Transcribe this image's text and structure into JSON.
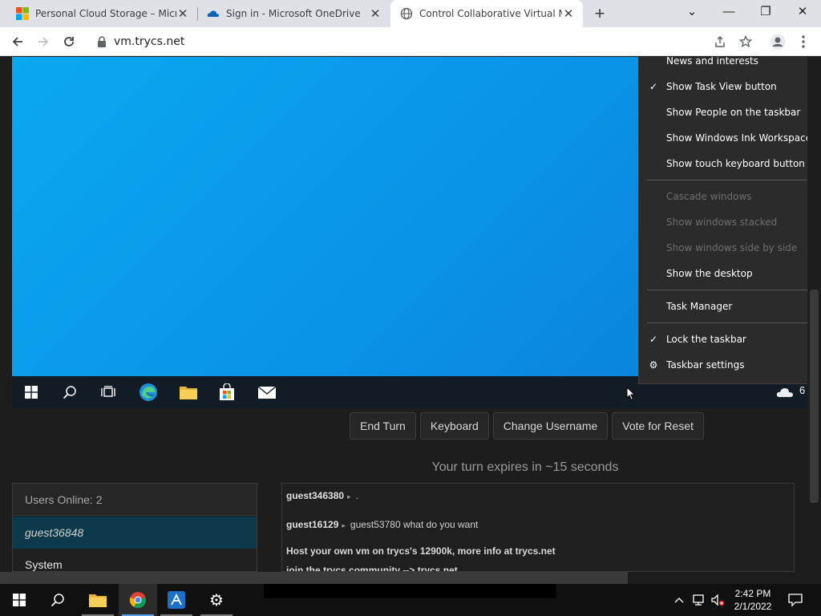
{
  "browser": {
    "tabs": [
      {
        "title": "Personal Cloud Storage – Microsoft OneDrive",
        "active": false
      },
      {
        "title": "Sign in - Microsoft OneDrive",
        "active": false
      },
      {
        "title": "Control Collaborative Virtual Machines",
        "active": true
      }
    ],
    "new_tab": "+",
    "window_controls": {
      "minimize": "—",
      "restore": "❐",
      "close": "✕",
      "tab_search": "⌄"
    },
    "url": "vm.trycs.net"
  },
  "context_menu": {
    "items": [
      {
        "label": "News and interests",
        "checked": false,
        "disabled": false
      },
      {
        "label": "Show Task View button",
        "checked": true,
        "disabled": false
      },
      {
        "label": "Show People on the taskbar",
        "checked": false,
        "disabled": false
      },
      {
        "label": "Show Windows Ink Workspace button",
        "checked": false,
        "disabled": false
      },
      {
        "label": "Show touch keyboard button",
        "checked": false,
        "disabled": false
      },
      {
        "label": "Cascade windows",
        "checked": false,
        "disabled": true
      },
      {
        "label": "Show windows stacked",
        "checked": false,
        "disabled": true
      },
      {
        "label": "Show windows side by side",
        "checked": false,
        "disabled": true
      },
      {
        "label": "Show the desktop",
        "checked": false,
        "disabled": false
      },
      {
        "label": "Task Manager",
        "checked": false,
        "disabled": false
      },
      {
        "label": "Lock the taskbar",
        "checked": true,
        "disabled": false
      },
      {
        "label": "Taskbar settings",
        "checked": false,
        "disabled": false
      }
    ]
  },
  "vm_taskbar": {
    "weather_temp": "6"
  },
  "controls": {
    "end_turn": "End Turn",
    "keyboard": "Keyboard",
    "change_username": "Change Username",
    "vote_reset": "Vote for Reset"
  },
  "turn_message": "Your turn expires in ~15 seconds",
  "users": {
    "header": "Users Online: 2",
    "list": [
      "guest36848",
      "System"
    ]
  },
  "chat": [
    {
      "user": "guest346380",
      "text": "."
    },
    {
      "user": "guest16129",
      "text": "guest53780 what do you want"
    }
  ],
  "chat_system": [
    "Host your own vm on trycs's 12900k, more info at trycs.net",
    "join the trycs community --> trycs.net"
  ],
  "host_taskbar": {
    "time": "2:42 PM",
    "date": "2/1/2022"
  },
  "colors": {
    "desktop_blue": "#0a9be8",
    "menu_bg": "#2b2b2b",
    "selected_user": "#0d3a4a"
  }
}
